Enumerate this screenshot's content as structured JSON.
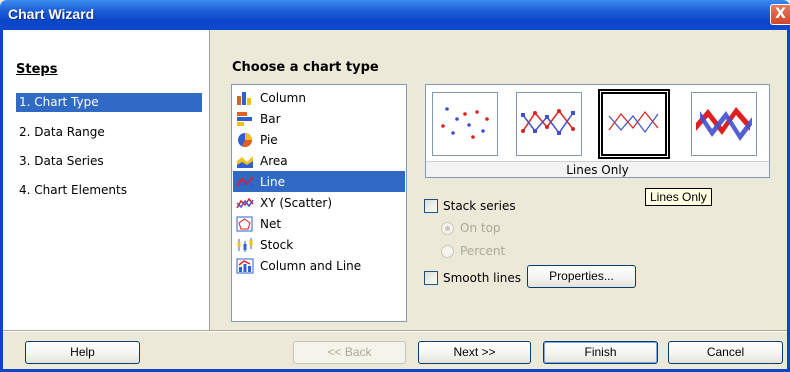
{
  "window": {
    "title": "Chart Wizard",
    "close_glyph": "X"
  },
  "steps": {
    "heading": "Steps",
    "items": [
      {
        "label": "1. Chart Type",
        "selected": true
      },
      {
        "label": "2. Data Range",
        "selected": false
      },
      {
        "label": "3. Data Series",
        "selected": false
      },
      {
        "label": "4. Chart Elements",
        "selected": false
      }
    ]
  },
  "chart_types": {
    "heading": "Choose a chart type",
    "items": [
      {
        "label": "Column",
        "icon": "column-chart-icon"
      },
      {
        "label": "Bar",
        "icon": "bar-chart-icon"
      },
      {
        "label": "Pie",
        "icon": "pie-chart-icon"
      },
      {
        "label": "Area",
        "icon": "area-chart-icon"
      },
      {
        "label": "Line",
        "icon": "line-chart-icon",
        "selected": true
      },
      {
        "label": "XY (Scatter)",
        "icon": "scatter-chart-icon"
      },
      {
        "label": "Net",
        "icon": "net-chart-icon"
      },
      {
        "label": "Stock",
        "icon": "stock-chart-icon"
      },
      {
        "label": "Column and Line",
        "icon": "column-line-chart-icon"
      }
    ]
  },
  "preview": {
    "caption": "Lines Only",
    "tooltip": "Lines Only",
    "variants": [
      "points-only",
      "points-and-lines",
      "lines-only",
      "3d-lines"
    ],
    "selected_variant": "lines-only"
  },
  "options": {
    "stack_series": {
      "label": "Stack series",
      "checked": false
    },
    "on_top": {
      "label": "On top",
      "selected": true,
      "enabled": false
    },
    "percent": {
      "label": "Percent",
      "selected": false,
      "enabled": false
    },
    "smooth_lines": {
      "label": "Smooth lines",
      "checked": false
    },
    "properties_label": "Properties..."
  },
  "buttons": {
    "help": "Help",
    "back": "<< Back",
    "next": "Next >>",
    "finish": "Finish",
    "cancel": "Cancel"
  },
  "colors": {
    "title_bar": "#0b46c8",
    "selection": "#316ac5",
    "series_red": "#e02020",
    "series_blue": "#4050d0"
  }
}
